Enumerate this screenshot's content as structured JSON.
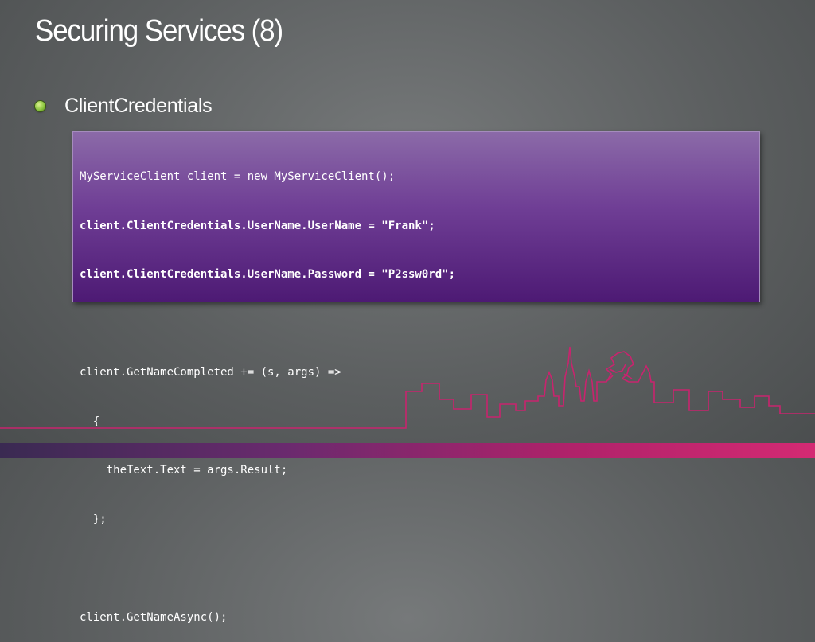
{
  "slide": {
    "title": "Securing Services (8)",
    "bullet": "ClientCredentials"
  },
  "code": {
    "lines": [
      {
        "text": "MyServiceClient client = new MyServiceClient();",
        "bold": false
      },
      {
        "text": "client.ClientCredentials.UserName.UserName = \"Frank\";",
        "bold": true
      },
      {
        "text": "client.ClientCredentials.UserName.Password = \"P2ssw0rd\";",
        "bold": true
      },
      {
        "text": "",
        "bold": false
      },
      {
        "text": "client.GetNameCompleted += (s, args) =>",
        "bold": false
      },
      {
        "text": "  {",
        "bold": false
      },
      {
        "text": "    theText.Text = args.Result;",
        "bold": false
      },
      {
        "text": "  };",
        "bold": false
      },
      {
        "text": "",
        "bold": false
      },
      {
        "text": "client.GetNameAsync();",
        "bold": false
      }
    ]
  },
  "colors": {
    "skyline": "#c8246e",
    "bullet": "#8cc63f",
    "code_bg": "#6f3e95"
  }
}
